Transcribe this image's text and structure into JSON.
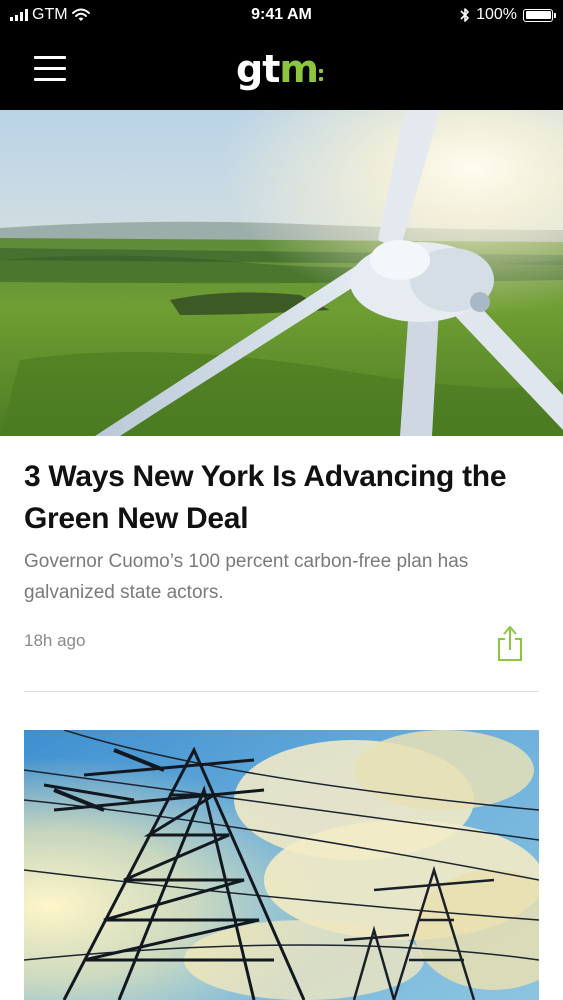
{
  "status_bar": {
    "carrier": "GTM",
    "time": "9:41 AM",
    "battery": "100%",
    "icons": [
      "signal-icon",
      "wifi-icon",
      "bluetooth-icon",
      "battery-icon"
    ]
  },
  "nav": {
    "logo_main": "gt",
    "logo_accent": "m",
    "menu_icon": "hamburger-menu-icon",
    "colors": {
      "background": "#000000",
      "accent": "#8cc63f"
    }
  },
  "articles": [
    {
      "image": "wind-turbine-over-green-fields",
      "headline": "3 Ways New York Is Advancing the Green New Deal",
      "summary": "Governor Cuomo’s 100 percent carbon-free plan has galvanized state actors.",
      "time_ago": "18h ago",
      "share_icon": "share-icon"
    },
    {
      "image": "power-transmission-towers-against-sky"
    }
  ]
}
